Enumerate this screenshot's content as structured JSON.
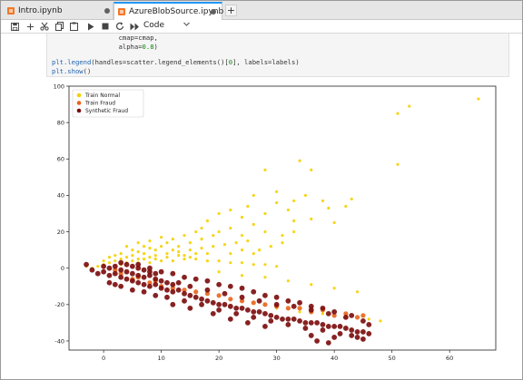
{
  "tabs": [
    {
      "label": "Intro.ipynb",
      "active": false
    },
    {
      "label": "AzureBlobSource.ipynb",
      "active": true
    }
  ],
  "tab_add_label": "+",
  "toolbar": {
    "kernel_mode": "Code",
    "icons": [
      "save-icon",
      "add-cell-icon",
      "cut-icon",
      "copy-icon",
      "paste-icon",
      "run-icon",
      "stop-icon",
      "restart-icon",
      "run-all-icon"
    ]
  },
  "code": {
    "line1_indent": "                 ",
    "line1_text": "cmap=cmap,",
    "line2_indent": "                 ",
    "line2_text_a": "alpha=",
    "line2_num": "0.8",
    "line2_text_b": ")",
    "line3_fn": "plt.legend",
    "line3_rest": "(handles=scatter.legend_elements()[",
    "line3_num": "0",
    "line3_end": "], labels=labels)",
    "line4_fn": "plt.show",
    "line4_rest": "()"
  },
  "colors": {
    "train_normal": "#f5d000",
    "train_fraud": "#e8641a",
    "synthetic_fraud": "#7a0a0a"
  },
  "chart_data": {
    "type": "scatter",
    "title": "",
    "xlabel": "",
    "ylabel": "",
    "xlim": [
      -6,
      68
    ],
    "ylim": [
      -45,
      100
    ],
    "xticks": [
      0,
      10,
      20,
      30,
      40,
      50,
      60
    ],
    "yticks": [
      -40,
      -20,
      0,
      20,
      40,
      60,
      80,
      100
    ],
    "legend_position": "top-left",
    "series": [
      {
        "name": "Train Normal",
        "points": [
          [
            65,
            93
          ],
          [
            51,
            85
          ],
          [
            53,
            89
          ],
          [
            51,
            57
          ],
          [
            34,
            59
          ],
          [
            36,
            54
          ],
          [
            28,
            54
          ],
          [
            30,
            42
          ],
          [
            38,
            37
          ],
          [
            42,
            34
          ],
          [
            43,
            38
          ],
          [
            39,
            33
          ],
          [
            33,
            37
          ],
          [
            35,
            40
          ],
          [
            30,
            36
          ],
          [
            26,
            40
          ],
          [
            25,
            34
          ],
          [
            22,
            32
          ],
          [
            28,
            30
          ],
          [
            32,
            32
          ],
          [
            33,
            26
          ],
          [
            36,
            27
          ],
          [
            40,
            25
          ],
          [
            24,
            28
          ],
          [
            20,
            30
          ],
          [
            18,
            26
          ],
          [
            17,
            22
          ],
          [
            22,
            22
          ],
          [
            26,
            24
          ],
          [
            24,
            18
          ],
          [
            20,
            20
          ],
          [
            19,
            18
          ],
          [
            16,
            20
          ],
          [
            14,
            18
          ],
          [
            12,
            16
          ],
          [
            15,
            14
          ],
          [
            17,
            16
          ],
          [
            13,
            12
          ],
          [
            11,
            14
          ],
          [
            10,
            12
          ],
          [
            9,
            10
          ],
          [
            8,
            11
          ],
          [
            7,
            8
          ],
          [
            6,
            9
          ],
          [
            5,
            7
          ],
          [
            4,
            6
          ],
          [
            3,
            5
          ],
          [
            2,
            4
          ],
          [
            1,
            3
          ],
          [
            0,
            2
          ],
          [
            -1,
            1
          ],
          [
            -2,
            0
          ],
          [
            -3,
            1
          ],
          [
            3,
            8
          ],
          [
            5,
            10
          ],
          [
            7,
            12
          ],
          [
            6,
            14
          ],
          [
            8,
            15
          ],
          [
            10,
            17
          ],
          [
            4,
            12
          ],
          [
            9,
            7
          ],
          [
            11,
            8
          ],
          [
            13,
            9
          ],
          [
            15,
            10
          ],
          [
            17,
            11
          ],
          [
            19,
            12
          ],
          [
            21,
            13
          ],
          [
            23,
            14
          ],
          [
            25,
            15
          ],
          [
            14,
            5
          ],
          [
            16,
            5
          ],
          [
            18,
            4
          ],
          [
            20,
            4
          ],
          [
            22,
            3
          ],
          [
            24,
            3
          ],
          [
            26,
            2
          ],
          [
            28,
            2
          ],
          [
            30,
            1
          ],
          [
            12,
            4
          ],
          [
            10,
            4
          ],
          [
            8,
            3
          ],
          [
            6,
            3
          ],
          [
            20,
            -2
          ],
          [
            24,
            -4
          ],
          [
            28,
            -5
          ],
          [
            32,
            -7
          ],
          [
            36,
            -9
          ],
          [
            40,
            -11
          ],
          [
            44,
            -13
          ],
          [
            46,
            -28
          ],
          [
            48,
            -29
          ],
          [
            42,
            -27
          ],
          [
            38,
            -25
          ],
          [
            34,
            -24
          ],
          [
            30,
            -22
          ],
          [
            27,
            10
          ],
          [
            29,
            12
          ],
          [
            31,
            14
          ],
          [
            26,
            8
          ],
          [
            33,
            20
          ],
          [
            31,
            18
          ],
          [
            28,
            20
          ],
          [
            24,
            10
          ],
          [
            22,
            8
          ],
          [
            18,
            8
          ],
          [
            16,
            8
          ],
          [
            12,
            10
          ],
          [
            14,
            7
          ],
          [
            2,
            7
          ],
          [
            1,
            6
          ],
          [
            0,
            4
          ],
          [
            3,
            2
          ],
          [
            5,
            4
          ],
          [
            7,
            5
          ],
          [
            9,
            5
          ],
          [
            11,
            6
          ],
          [
            13,
            7
          ],
          [
            15,
            6
          ],
          [
            4,
            3
          ],
          [
            6,
            5
          ],
          [
            8,
            6
          ]
        ]
      },
      {
        "name": "Train Fraud",
        "points": [
          [
            5,
            -6
          ],
          [
            8,
            -8
          ],
          [
            10,
            -10
          ],
          [
            14,
            -12
          ],
          [
            18,
            -14
          ],
          [
            22,
            -17
          ],
          [
            26,
            -19
          ],
          [
            30,
            -21
          ],
          [
            34,
            -22
          ],
          [
            38,
            -23
          ],
          [
            42,
            -25
          ],
          [
            45,
            -26
          ],
          [
            12,
            -11
          ],
          [
            16,
            -13
          ],
          [
            20,
            -15
          ],
          [
            24,
            -18
          ],
          [
            28,
            -20
          ],
          [
            32,
            -22
          ],
          [
            36,
            -24
          ],
          [
            40,
            -26
          ],
          [
            44,
            -27
          ],
          [
            3,
            -3
          ],
          [
            6,
            -5
          ],
          [
            9,
            -7
          ],
          [
            2,
            -1
          ]
        ]
      },
      {
        "name": "Synthetic Fraud",
        "points": [
          [
            -3,
            2
          ],
          [
            -2,
            -1
          ],
          [
            -1,
            -3
          ],
          [
            0,
            -2
          ],
          [
            1,
            -4
          ],
          [
            2,
            -3
          ],
          [
            3,
            -5
          ],
          [
            4,
            -6
          ],
          [
            5,
            -7
          ],
          [
            6,
            -8
          ],
          [
            7,
            -9
          ],
          [
            8,
            -10
          ],
          [
            9,
            -9
          ],
          [
            10,
            -11
          ],
          [
            11,
            -12
          ],
          [
            12,
            -13
          ],
          [
            13,
            -12
          ],
          [
            14,
            -14
          ],
          [
            15,
            -15
          ],
          [
            16,
            -16
          ],
          [
            17,
            -17
          ],
          [
            18,
            -18
          ],
          [
            19,
            -19
          ],
          [
            20,
            -20
          ],
          [
            21,
            -20
          ],
          [
            22,
            -21
          ],
          [
            23,
            -22
          ],
          [
            24,
            -22
          ],
          [
            25,
            -23
          ],
          [
            26,
            -24
          ],
          [
            27,
            -24
          ],
          [
            28,
            -25
          ],
          [
            29,
            -26
          ],
          [
            30,
            -27
          ],
          [
            31,
            -28
          ],
          [
            32,
            -28
          ],
          [
            33,
            -28
          ],
          [
            34,
            -29
          ],
          [
            35,
            -30
          ],
          [
            36,
            -30
          ],
          [
            37,
            -30
          ],
          [
            38,
            -31
          ],
          [
            39,
            -32
          ],
          [
            40,
            -32
          ],
          [
            41,
            -32
          ],
          [
            42,
            -33
          ],
          [
            43,
            -34
          ],
          [
            44,
            -35
          ],
          [
            45,
            -35
          ],
          [
            0,
            1
          ],
          [
            1,
            0
          ],
          [
            2,
            1
          ],
          [
            3,
            -1
          ],
          [
            4,
            -2
          ],
          [
            5,
            -3
          ],
          [
            6,
            -4
          ],
          [
            7,
            -5
          ],
          [
            8,
            -4
          ],
          [
            9,
            -6
          ],
          [
            10,
            -7
          ],
          [
            11,
            -8
          ],
          [
            12,
            -9
          ],
          [
            13,
            -8
          ],
          [
            4,
            2
          ],
          [
            5,
            1
          ],
          [
            6,
            0
          ],
          [
            7,
            -1
          ],
          [
            8,
            -2
          ],
          [
            9,
            -3
          ],
          [
            3,
            3
          ],
          [
            1,
            -8
          ],
          [
            2,
            -9
          ],
          [
            3,
            -10
          ],
          [
            5,
            -12
          ],
          [
            7,
            -13
          ],
          [
            9,
            -15
          ],
          [
            11,
            -16
          ],
          [
            14,
            -18
          ],
          [
            17,
            -20
          ],
          [
            20,
            -23
          ],
          [
            23,
            -25
          ],
          [
            26,
            -27
          ],
          [
            29,
            -29
          ],
          [
            32,
            -31
          ],
          [
            35,
            -33
          ],
          [
            38,
            -34
          ],
          [
            41,
            -36
          ],
          [
            44,
            -38
          ],
          [
            37,
            -40
          ],
          [
            40,
            -38
          ],
          [
            43,
            -37
          ],
          [
            45,
            -39
          ],
          [
            46,
            -36
          ],
          [
            36,
            -37
          ],
          [
            39,
            -41
          ],
          [
            15,
            -10
          ],
          [
            18,
            -12
          ],
          [
            21,
            -14
          ],
          [
            24,
            -16
          ],
          [
            27,
            -18
          ],
          [
            30,
            -20
          ],
          [
            33,
            -21
          ],
          [
            36,
            -23
          ],
          [
            39,
            -25
          ],
          [
            42,
            -27
          ],
          [
            45,
            -29
          ],
          [
            46,
            -31
          ],
          [
            14,
            -5
          ],
          [
            16,
            -6
          ],
          [
            18,
            -7
          ],
          [
            20,
            -9
          ],
          [
            22,
            -10
          ],
          [
            12,
            -3
          ],
          [
            10,
            -2
          ],
          [
            8,
            0
          ],
          [
            6,
            2
          ],
          [
            24,
            -11
          ],
          [
            26,
            -13
          ],
          [
            28,
            -15
          ],
          [
            30,
            -16
          ],
          [
            32,
            -18
          ],
          [
            34,
            -19
          ],
          [
            36,
            -21
          ],
          [
            38,
            -22
          ],
          [
            40,
            -24
          ],
          [
            43,
            -26
          ],
          [
            19,
            -25
          ],
          [
            22,
            -28
          ],
          [
            25,
            -30
          ],
          [
            28,
            -32
          ],
          [
            15,
            -22
          ],
          [
            12,
            -20
          ]
        ]
      }
    ]
  }
}
